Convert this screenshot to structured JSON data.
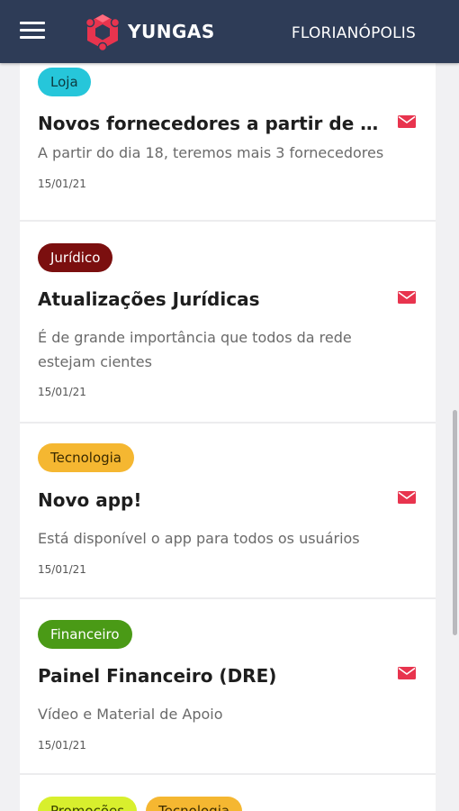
{
  "header": {
    "brand": "YUNGAS",
    "city": "FLORIANÓPOLIS",
    "colors": {
      "bar": "#2e3c57",
      "logo": "#e8344e"
    }
  },
  "feed": [
    {
      "tags": [
        {
          "label": "Loja",
          "color": "#26c6da"
        }
      ],
      "title": "Novos fornecedores a partir de s...",
      "description": "A partir do dia 18, teremos mais 3 fornecedores",
      "date": "15/01/21",
      "icon": "mail-icon"
    },
    {
      "tags": [
        {
          "label": "Jurídico",
          "color": "#7b0f0f"
        }
      ],
      "title": "Atualizações Jurídicas",
      "description": "É de grande importância que todos da rede estejam cientes",
      "date": "15/01/21",
      "icon": "mail-icon"
    },
    {
      "tags": [
        {
          "label": "Tecnologia",
          "color": "#f5b731"
        }
      ],
      "title": "Novo app!",
      "description": "Está disponível o app para todos os usuários",
      "date": "15/01/21",
      "icon": "mail-icon"
    },
    {
      "tags": [
        {
          "label": "Financeiro",
          "color": "#4a9a16"
        }
      ],
      "title": "Painel Financeiro (DRE)",
      "description": "Vídeo e Material de Apoio",
      "date": "15/01/21",
      "icon": "mail-icon"
    },
    {
      "tags": [
        {
          "label": "Promoções",
          "color": "#d8ef2d"
        },
        {
          "label": "Tecnologia",
          "color": "#f5b731"
        }
      ]
    }
  ]
}
